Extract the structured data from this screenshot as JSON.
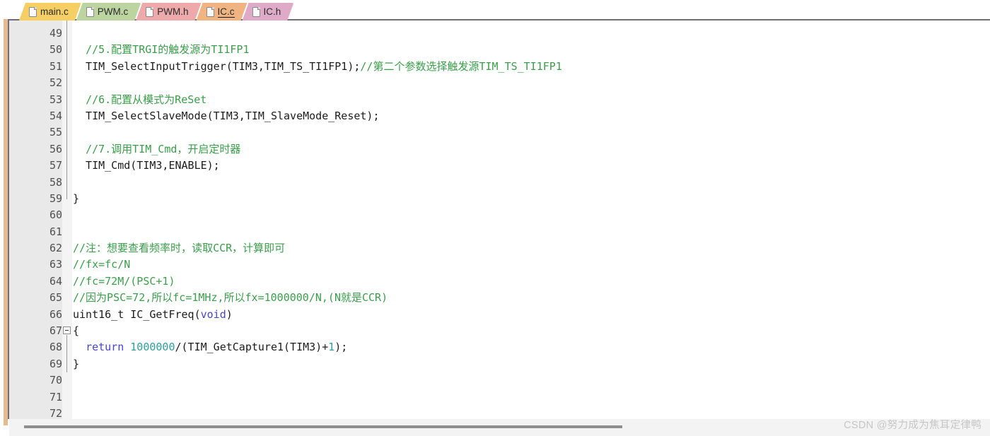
{
  "window": {
    "title": "IC.c",
    "accent_color": "#e8b98f",
    "editor_bg": "#ffffff",
    "gutter_bg": "#e9e9e9"
  },
  "tabs": [
    {
      "label": "main.c",
      "color": "#f5cf64",
      "active": false,
      "icon": "document-icon"
    },
    {
      "label": "PWM.c",
      "color": "#bcd4a0",
      "active": false,
      "icon": "document-icon"
    },
    {
      "label": "PWM.h",
      "color": "#eeaaaa",
      "active": false,
      "icon": "document-icon"
    },
    {
      "label": "IC.c",
      "color": "#f0b482",
      "active": true,
      "icon": "document-icon"
    },
    {
      "label": "IC.h",
      "color": "#dfaac8",
      "active": false,
      "icon": "document-icon"
    }
  ],
  "editor": {
    "first_line": 49,
    "last_line": 72,
    "line_numbers": [
      49,
      50,
      51,
      52,
      53,
      54,
      55,
      56,
      57,
      58,
      59,
      60,
      61,
      62,
      63,
      64,
      65,
      66,
      67,
      68,
      69,
      70,
      71,
      72
    ],
    "fold_markers": [
      {
        "line": 67,
        "type": "collapse-box"
      }
    ],
    "lines": [
      {
        "n": 49,
        "tokens": []
      },
      {
        "n": 50,
        "tokens": [
          {
            "t": "plain",
            "s": "  "
          },
          {
            "t": "comment",
            "s": "//5.配置TRGI的触发源为TI1FP1"
          }
        ]
      },
      {
        "n": 51,
        "tokens": [
          {
            "t": "plain",
            "s": "  TIM_SelectInputTrigger(TIM3,TIM_TS_TI1FP1);"
          },
          {
            "t": "comment",
            "s": "//第二个参数选择触发源TIM_TS_TI1FP1"
          }
        ]
      },
      {
        "n": 52,
        "tokens": []
      },
      {
        "n": 53,
        "tokens": [
          {
            "t": "plain",
            "s": "  "
          },
          {
            "t": "comment",
            "s": "//6.配置从模式为ReSet"
          }
        ]
      },
      {
        "n": 54,
        "tokens": [
          {
            "t": "plain",
            "s": "  TIM_SelectSlaveMode(TIM3,TIM_SlaveMode_Reset);"
          }
        ]
      },
      {
        "n": 55,
        "tokens": []
      },
      {
        "n": 56,
        "tokens": [
          {
            "t": "plain",
            "s": "  "
          },
          {
            "t": "comment",
            "s": "//7.调用TIM_Cmd，开启定时器"
          }
        ]
      },
      {
        "n": 57,
        "tokens": [
          {
            "t": "plain",
            "s": "  TIM_Cmd(TIM3,ENABLE);"
          }
        ]
      },
      {
        "n": 58,
        "tokens": []
      },
      {
        "n": 59,
        "tokens": [
          {
            "t": "plain",
            "s": "}"
          }
        ]
      },
      {
        "n": 60,
        "tokens": []
      },
      {
        "n": 61,
        "tokens": []
      },
      {
        "n": 62,
        "tokens": [
          {
            "t": "comment",
            "s": "//注：想要查看频率时，读取CCR，计算即可"
          }
        ]
      },
      {
        "n": 63,
        "tokens": [
          {
            "t": "comment",
            "s": "//fx=fc/N"
          }
        ]
      },
      {
        "n": 64,
        "tokens": [
          {
            "t": "comment",
            "s": "//fc=72M/(PSC+1)"
          }
        ]
      },
      {
        "n": 65,
        "tokens": [
          {
            "t": "comment",
            "s": "//因为PSC=72,所以fc=1MHz,所以fx=1000000/N,(N就是CCR)"
          }
        ]
      },
      {
        "n": 66,
        "tokens": [
          {
            "t": "plain",
            "s": "uint16_t IC_GetFreq("
          },
          {
            "t": "kw",
            "s": "void"
          },
          {
            "t": "plain",
            "s": ")"
          }
        ]
      },
      {
        "n": 67,
        "tokens": [
          {
            "t": "plain",
            "s": "{"
          }
        ]
      },
      {
        "n": 68,
        "tokens": [
          {
            "t": "plain",
            "s": "  "
          },
          {
            "t": "kw",
            "s": "return"
          },
          {
            "t": "plain",
            "s": " "
          },
          {
            "t": "num",
            "s": "1000000"
          },
          {
            "t": "plain",
            "s": "/(TIM_GetCapture1(TIM3)+"
          },
          {
            "t": "num",
            "s": "1"
          },
          {
            "t": "plain",
            "s": ");"
          }
        ]
      },
      {
        "n": 69,
        "tokens": [
          {
            "t": "plain",
            "s": "}"
          }
        ]
      },
      {
        "n": 70,
        "tokens": []
      },
      {
        "n": 71,
        "tokens": []
      },
      {
        "n": 72,
        "tokens": []
      }
    ],
    "syntax_colors": {
      "comment": "#3a9e4a",
      "keyword": "#4646c8",
      "number": "#2f9e9e",
      "plain": "#1c1c1c"
    }
  },
  "scrollbar": {
    "orientation": "horizontal",
    "thumb_start_pct": 1.5,
    "thumb_width_pct": 61
  },
  "watermark": {
    "text": "CSDN @努力成为焦耳定律鸭"
  }
}
